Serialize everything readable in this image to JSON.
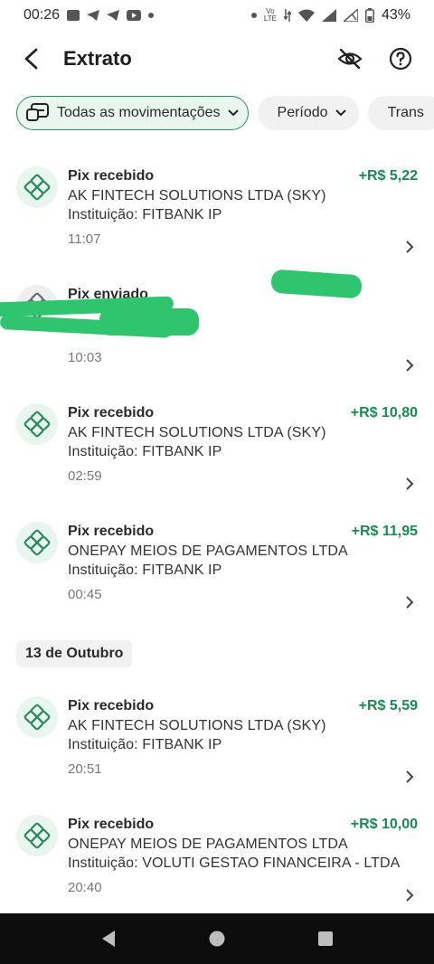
{
  "status_bar": {
    "time": "00:26",
    "carrier_tag_top": "Vo",
    "carrier_tag_bottom": "LTE",
    "battery": "43%"
  },
  "header": {
    "title": "Extrato"
  },
  "filters": {
    "all": "Todas as movimentações",
    "period": "Período",
    "type": "Trans"
  },
  "transactions_group1": [
    {
      "type": "Pix recebido",
      "amount": "+R$ 5,22",
      "line1": "AK FINTECH SOLUTIONS LTDA (SKY)",
      "line2": "Instituição: FITBANK IP",
      "time": "11:07"
    },
    {
      "type": "Pix enviado",
      "amount": "",
      "line1": "",
      "line2": "",
      "time": "10:03"
    },
    {
      "type": "Pix recebido",
      "amount": "+R$ 10,80",
      "line1": "AK FINTECH SOLUTIONS LTDA (SKY)",
      "line2": "Instituição: FITBANK IP",
      "time": "02:59"
    },
    {
      "type": "Pix recebido",
      "amount": "+R$ 11,95",
      "line1": "ONEPAY MEIOS DE PAGAMENTOS LTDA",
      "line2": "Instituição: FITBANK IP",
      "time": "00:45"
    }
  ],
  "date_separator": "13 de Outubro",
  "transactions_group2": [
    {
      "type": "Pix recebido",
      "amount": "+R$ 5,59",
      "line1": "AK FINTECH SOLUTIONS LTDA (SKY)",
      "line2": "Instituição: FITBANK IP",
      "time": "20:51"
    },
    {
      "type": "Pix recebido",
      "amount": "+R$ 10,00",
      "line1": "ONEPAY MEIOS DE PAGAMENTOS LTDA",
      "line2": "Instituição: VOLUTI GESTAO FINANCEIRA - LTDA",
      "time": "20:40"
    }
  ],
  "colors": {
    "accent": "#2c8a62",
    "amount_positive": "#1a8a55",
    "redaction": "#2fc46e"
  }
}
